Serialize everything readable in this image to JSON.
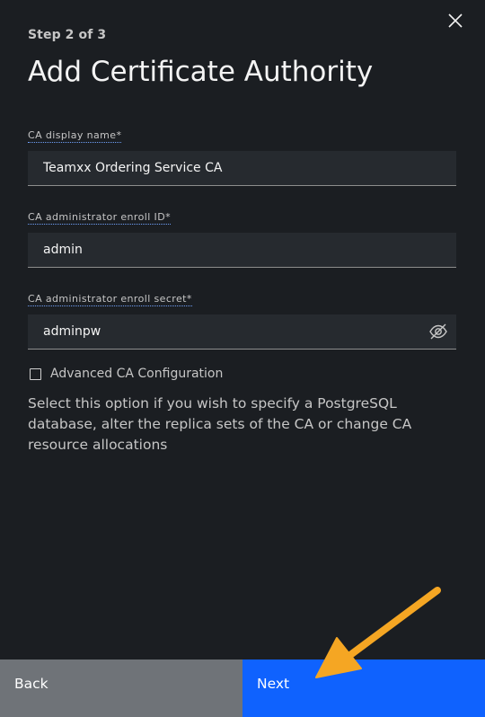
{
  "header": {
    "step": "Step 2 of 3",
    "title": "Add Certificate Authority"
  },
  "form": {
    "display_name": {
      "label": "CA display name*",
      "value": "Teamxx Ordering Service CA"
    },
    "enroll_id": {
      "label": "CA administrator enroll ID*",
      "value": "admin"
    },
    "enroll_secret": {
      "label": "CA administrator enroll secret*",
      "value": "adminpw"
    },
    "advanced": {
      "label": "Advanced CA Configuration",
      "checked": false,
      "helper": "Select this option if you wish to specify a PostgreSQL database, alter the replica sets of the CA or change CA resource allocations"
    }
  },
  "footer": {
    "back_label": "Back",
    "next_label": "Next"
  },
  "colors": {
    "background": "#1b1e22",
    "field": "#262a2f",
    "back_button": "#6f7378",
    "next_button": "#0f62fe",
    "annotation_arrow": "#f5a623"
  },
  "icons": {
    "close": "close-icon",
    "password_visibility": "eye-off-icon"
  }
}
